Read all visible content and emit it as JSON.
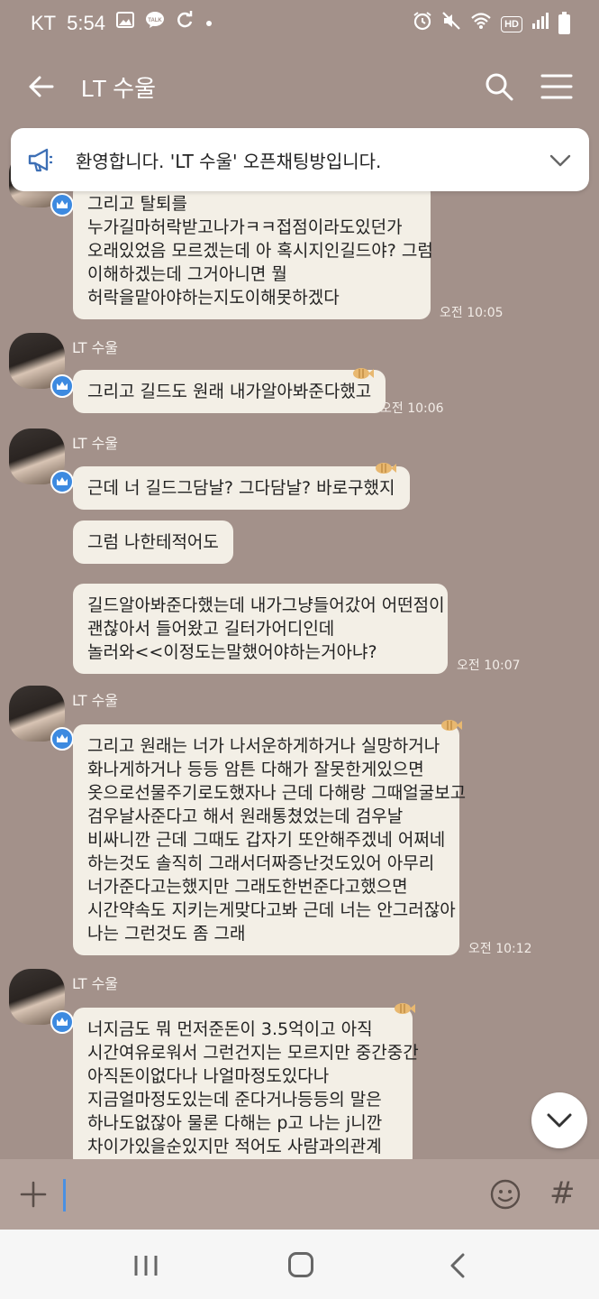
{
  "status_bar": {
    "carrier": "KT",
    "time": "5:54",
    "left_icons": [
      "gallery-icon",
      "talk-icon",
      "sync-icon",
      "dot-icon"
    ],
    "right_icons": [
      "alarm-icon",
      "mute-icon",
      "wifi-icon",
      "hd-icon",
      "signal-icon",
      "battery-icon"
    ],
    "hd_label": "HD"
  },
  "header": {
    "title": "LT 수울",
    "back_icon": "arrow-left-icon",
    "search_icon": "search-icon",
    "menu_icon": "menu-icon"
  },
  "notice": {
    "text": "환영합니다. 'LT 수울' 오픈채팅방입니다.",
    "icon": "megaphone-icon"
  },
  "messages": {
    "m1": {
      "text": "그리고 탈퇴를\n누가길마허락받고나가ㅋㅋ접점이라도있던가\n오래있었음 모르겠는데 아 혹시지인길드야? 그럼\n이해하겠는데 그거아니면 뭘\n허락을맡아야하는지도이해못하겠다",
      "time": "오전 10:05"
    },
    "g1": {
      "sender": "LT 수울",
      "m2": {
        "text": "그리고 길드도 원래 내가알아봐준다했고",
        "time": "오전 10:06"
      }
    },
    "g2": {
      "sender": "LT 수울",
      "m3": {
        "text": "근데 너 길드그담날? 그다담날? 바로구했지"
      },
      "m4": {
        "text": "그럼 나한테적어도"
      },
      "m5": {
        "text": "길드알아봐준다했는데 내가그냥들어갔어 어떤점이\n괜찮아서 들어왔고 길터가어디인데\n놀러와<<이정도는말했어야하는거아냐?",
        "time": "오전 10:07"
      }
    },
    "g3": {
      "sender": "LT 수울",
      "m6": {
        "text": "그리고 원래는 너가 나서운하게하거나 실망하거나\n화나게하거나 등등 암튼 다해가 잘못한게있으면\n옷으로선물주기로도했자나 근데 다해랑 그때얼굴보고\n검우날사준다고 해서 원래통쳤었는데 검우날\n비싸니깐 근데 그때도 갑자기 또안해주겠네 어쩌네\n하는것도 솔직히 그래서더짜증난것도있어 아무리\n너가준다고는했지만 그래도한번준다고했으면\n시간약속도 지키는게맞다고봐 근데 너는 안그러잖아\n나는 그런것도 좀 그래",
        "time": "오전 10:12"
      }
    },
    "g4": {
      "sender": "LT 수울",
      "m7": {
        "text": "너지금도 뭐 먼저준돈이 3.5억이고 아직\n시간여유로워서 그런건지는 모르지만 중간중간\n아직돈이없다나 나얼마정도있다나\n지금얼마정도있는데 준다거나등등의 말은\n하나도없잖아 물론 다해는 p고 나는 j니깐\n차이가있을순있지만 적어도 사람과의관계"
      }
    }
  },
  "input_bar": {
    "plus_icon": "plus-icon",
    "emoji_icon": "emoji-icon",
    "hash_label": "#"
  },
  "scroll_button": {
    "icon": "chevron-down-icon"
  },
  "nav_bar": {
    "recent_icon": "recent-apps-icon",
    "home_icon": "home-icon",
    "back_icon": "nav-back-icon"
  },
  "colors": {
    "background": "#a3918a",
    "bubble": "#f3efe6",
    "crown_badge": "#3d8ae0",
    "caret": "#4a90e2"
  }
}
